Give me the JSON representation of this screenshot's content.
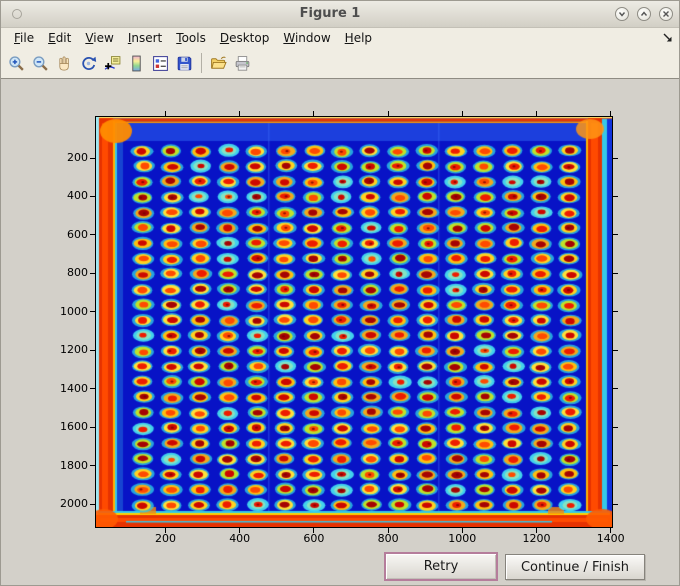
{
  "window": {
    "title": "Figure 1"
  },
  "menu": {
    "items": [
      "File",
      "Edit",
      "View",
      "Insert",
      "Tools",
      "Desktop",
      "Window",
      "Help"
    ]
  },
  "toolbar": {
    "buttons": [
      "zoom-in",
      "zoom-out",
      "pan",
      "rotate-3d",
      "data-cursor",
      "insert-colorbar",
      "insert-legend",
      "save-figure",
      "open-file",
      "print-figure"
    ]
  },
  "icons": {
    "window_controls": [
      "shade-window",
      "maximize-window",
      "close-window"
    ],
    "titlebar_left": "window-menu",
    "menu_corner": "dock-figure-arrow"
  },
  "buttons": {
    "retry": "Retry",
    "continue_finish": "Continue / Finish"
  },
  "ui_colors": {
    "chrome_beige": "#f0ede3",
    "titlebar": "#ddd9cf",
    "figure_background": "#d3d0c9",
    "retry_focus_border": "#b57d9b"
  },
  "chart_data": {
    "type": "heatmap",
    "title": "",
    "xlabel": "",
    "ylabel": "",
    "x_ticks": [
      200,
      400,
      600,
      800,
      1000,
      1200,
      1400
    ],
    "y_ticks": [
      200,
      400,
      600,
      800,
      1000,
      1200,
      1400,
      1600,
      1800,
      2000
    ],
    "xlim": [
      0,
      1410
    ],
    "ylim": [
      0,
      2120
    ],
    "y_axis_direction": "reversed-image-coordinates",
    "colormap": "jet",
    "grid_rows": 24,
    "grid_cols": 16,
    "description": "False-color (jet colormap) intensity scan of a 384-well microplate: 24 rows x 16 columns of wells, each with a hot red-orange core ringed by yellow then cyan, on a deep blue plate body; plate rim glows red-orange with thick left/right/bottom edges and a thin top edge.",
    "colors": {
      "plate_blue": "#0813c6",
      "edge_red": "#e63200",
      "edge_hot": "#ff4a00",
      "halo_cyan": "#2dc8e6",
      "ring_palette": [
        "#ffd321",
        "#ffc010",
        "#ffe13a",
        "#f2a91c",
        "#bfe32a"
      ],
      "core_palette": [
        "#ee1c00",
        "#cc0700",
        "#ff4a00",
        "#a50303"
      ]
    }
  }
}
